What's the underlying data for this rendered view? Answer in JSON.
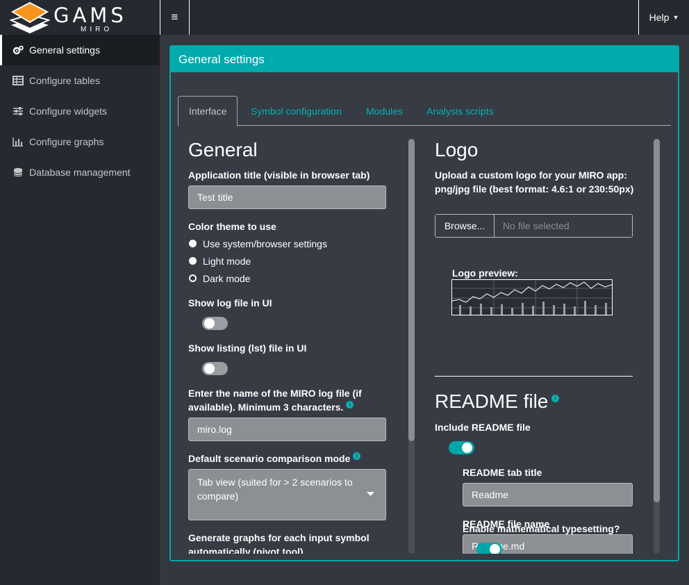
{
  "app": {
    "logo_word": "GAMS",
    "logo_sub": "MIRO",
    "menu_toggle": "≡",
    "help_label": "Help",
    "help_caret": "▼"
  },
  "sidebar": {
    "items": [
      {
        "label": "General settings",
        "icon": "gears-icon"
      },
      {
        "label": "Configure tables",
        "icon": "table-icon"
      },
      {
        "label": "Configure widgets",
        "icon": "sliders-icon"
      },
      {
        "label": "Configure graphs",
        "icon": "chart-icon"
      },
      {
        "label": "Database management",
        "icon": "database-icon"
      }
    ]
  },
  "panel": {
    "title": "General settings"
  },
  "tabs": [
    "Interface",
    "Symbol configuration",
    "Modules",
    "Analysis scripts"
  ],
  "general": {
    "heading": "General",
    "app_title_label": "Application title (visible in browser tab)",
    "app_title_value": "Test title",
    "theme_label": "Color theme to use",
    "theme_options": [
      "Use system/browser settings",
      "Light mode",
      "Dark mode"
    ],
    "theme_selected": "Dark mode",
    "log_label": "Show log file in UI",
    "log_enabled": false,
    "lst_label": "Show listing (lst) file in UI",
    "lst_enabled": false,
    "logfile_label": "Enter the name of the MIRO log file (if available). Minimum 3 characters.",
    "logfile_value": "miro.log",
    "compare_label": "Default scenario comparison mode",
    "compare_value": "Tab view (suited for > 2 scenarios to compare)",
    "pivot_label": "Generate graphs for each input symbol automatically (pivot tool)"
  },
  "logo": {
    "heading": "Logo",
    "upload_label": "Upload a custom logo for your MIRO app: png/jpg file (best format: 4.6:1 or 230:50px)",
    "browse_label": "Browse...",
    "file_placeholder": "No file selected",
    "preview_label": "Logo preview:"
  },
  "readme": {
    "heading": "README file",
    "include_label": "Include README file",
    "include_enabled": true,
    "tab_title_label": "README tab title",
    "tab_title_value": "Readme",
    "file_name_label": "README file name",
    "file_name_value": "Readme.md",
    "math_label": "Enable mathematical typesetting?",
    "math_enabled": true
  },
  "colors": {
    "accent": "#00aaad",
    "background": "#262a30",
    "panel": "#373b44"
  }
}
